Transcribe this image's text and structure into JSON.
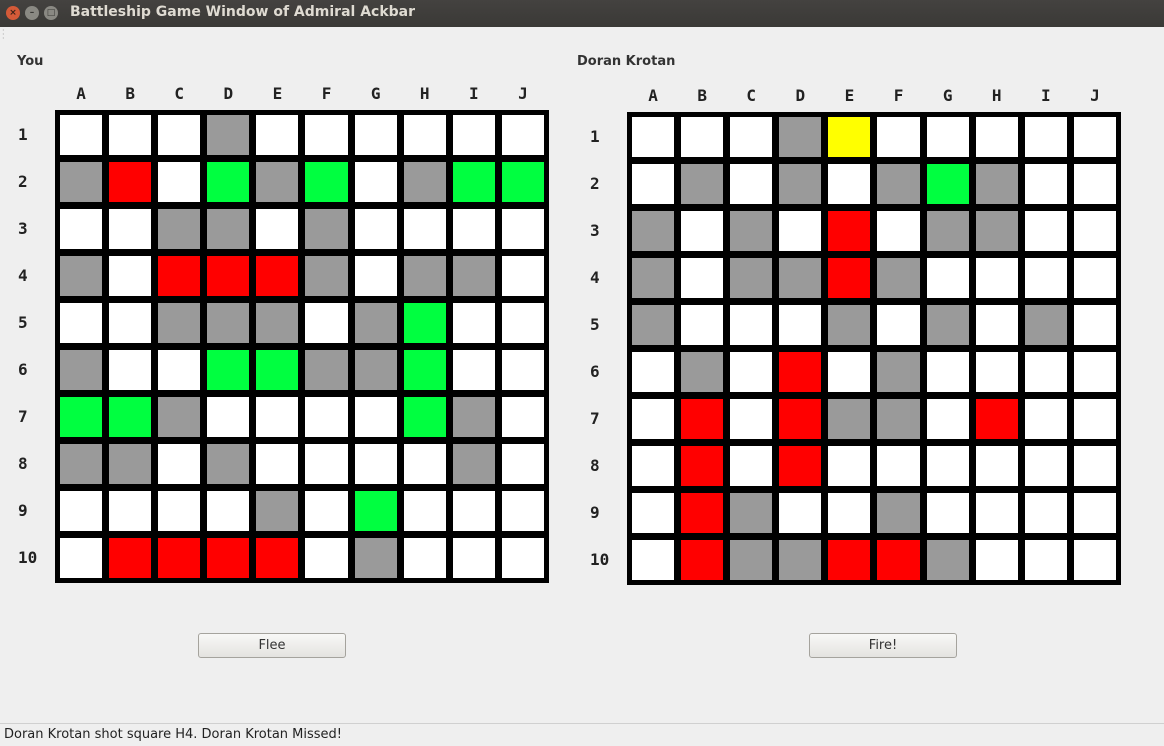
{
  "window": {
    "title": "Battleship Game Window of Admiral Ackbar"
  },
  "colors": {
    "empty": "#ffffff",
    "miss": "#9a9a9a",
    "hit": "#ff0000",
    "ship": "#00ff40",
    "selected": "#ffff00"
  },
  "columns": [
    "A",
    "B",
    "C",
    "D",
    "E",
    "F",
    "G",
    "H",
    "I",
    "J"
  ],
  "rows": [
    "1",
    "2",
    "3",
    "4",
    "5",
    "6",
    "7",
    "8",
    "9",
    "10"
  ],
  "own_board": {
    "name": "You",
    "cells": [
      "WWWMWWWWWW",
      "MHWSMSWMSS",
      "WWMMWMWWWW",
      "MWHHHMWMMW",
      "WWMMMWMSWW",
      "MWWSSMMSWW",
      "SSMWWWWSMW",
      "MMWMWWWWMW",
      "WWWWMWSWWW",
      "WHHHHWMWWW"
    ]
  },
  "enemy_board": {
    "name": "Doran Krotan",
    "cells": [
      "WWWMYWWWWW",
      "WMWMWMSMWW",
      "MWMWHWMMWW",
      "MWMMHMWWWW",
      "MWWWMWMWMW",
      "WMWHWMWWWW",
      "WHWHMMWHWW",
      "WHWHWWWWWW",
      "WHMWWMWWWW",
      "WHMMHHMWWW"
    ]
  },
  "buttons": {
    "flee": "Flee",
    "fire": "Fire!"
  },
  "status": "Doran Krotan shot square H4. Doran Krotan Missed!"
}
